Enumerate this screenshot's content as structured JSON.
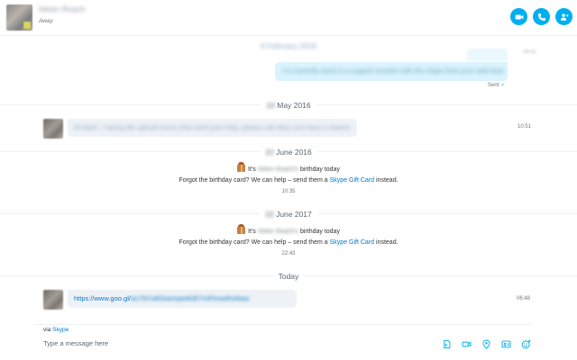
{
  "header": {
    "contact_name": "Helen Roach",
    "status": "Away",
    "buttons": {
      "video": "video-call",
      "call": "audio-call",
      "add": "add-people"
    }
  },
  "chat": {
    "dates": {
      "d1": "6 February 2016",
      "d2_day": "10",
      "d2_rest": "May 2016",
      "d3_day": "22",
      "d3_rest": "June 2016",
      "d4_day": "22",
      "d4_rest": "June 2017",
      "today": "Today"
    },
    "sent_message": {
      "text": "I'm currently stuck in a support session with the chaps from your web host",
      "time": "09:41",
      "status": "Sent"
    },
    "incoming_1": {
      "text": "Hi Mark – having file upload issues that need your help, please call when you have a chance",
      "time": "10:51"
    },
    "birthday_1": {
      "prefix": "It's",
      "name": "Helen Roach's",
      "suffix": "birthday today",
      "line2_before": "Forgot the birthday card? We can help – send them a",
      "link": "Skype Gift Card",
      "line2_after": "instead.",
      "time": "10:35"
    },
    "birthday_2": {
      "prefix": "It's",
      "name": "Helen Roach's",
      "suffix": "birthday today",
      "line2_before": "Forgot the birthday card? We can help – send them a",
      "link": "Skype Gift Card",
      "line2_after": "instead.",
      "time": "22:43"
    },
    "incoming_2": {
      "url_visible": "https://www.goo.gl/",
      "url_blurred": "aU7bYwEGarmpedGE7mFhnw4hvfwas",
      "time": "06:48"
    }
  },
  "footer": {
    "via_prefix": "via",
    "via_link": "Skype",
    "placeholder": "Type a message here",
    "icons": [
      "file-icon",
      "video-message-icon",
      "location-icon",
      "contact-card-icon",
      "emoticon-icon"
    ]
  },
  "colors": {
    "accent": "#00aff0",
    "link": "#0078c8",
    "sent_bubble": "#daf3fd",
    "incoming_bubble": "#eef2f6"
  }
}
